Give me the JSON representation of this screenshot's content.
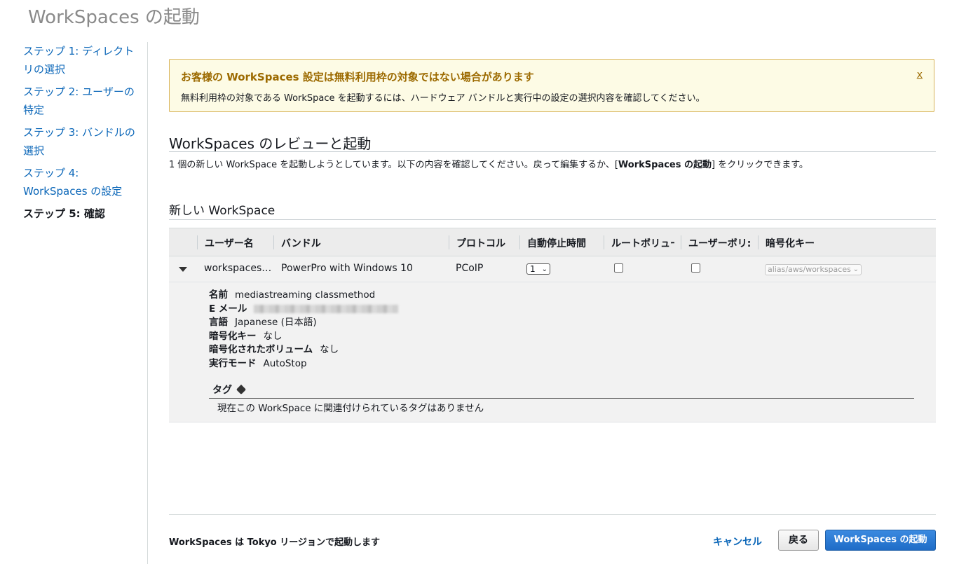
{
  "page": {
    "title": "WorkSpaces の起動"
  },
  "sidebar": {
    "steps": [
      {
        "label": "ステップ 1: ディレクトリの選択"
      },
      {
        "label": "ステップ 2: ユーザーの特定"
      },
      {
        "label": "ステップ 3: バンドルの選択"
      },
      {
        "label": "ステップ 4: WorkSpaces の設定"
      },
      {
        "label": "ステップ 5: 確認",
        "current": true
      }
    ]
  },
  "alert": {
    "title": "お客様の WorkSpaces 設定は無料利用枠の対象ではない場合があります",
    "body": "無料利用枠の対象である WorkSpace を起動するには、ハードウェア バンドルと実行中の設定の選択内容を確認してください。",
    "close": "x",
    "colors": {
      "background": "#fdfbe5",
      "border": "#d8b35a",
      "title": "#9c6a00"
    }
  },
  "review": {
    "title": "WorkSpaces のレビューと起動",
    "intro_pre": "1 個の新しい WorkSpace を起動しようとしています。以下の内容を確認してください。戻って編集するか、[",
    "intro_bold": "WorkSpaces の起動",
    "intro_post": "] をクリックできます。"
  },
  "new_workspace": {
    "title": "新しい WorkSpace",
    "columns": [
      "ユーザー名",
      "バンドル",
      "プロトコル",
      "自動停止時間",
      "ルートボリュー",
      "ユーザーボリ:",
      "暗号化キー"
    ],
    "row": {
      "username": "workspaces…",
      "bundle": "PowerPro with Windows 10",
      "protocol": "PCoIP",
      "auto_stop": "1",
      "root_volume_encrypted": false,
      "user_volume_encrypted": false,
      "encryption_key": "alias/aws/workspaces"
    },
    "details": {
      "name_label": "名前",
      "name_value": "mediastreaming classmethod",
      "email_label": "E メール",
      "language_label": "言語",
      "language_value": "Japanese (日本語)",
      "key_label": "暗号化キー",
      "key_value": "なし",
      "volumes_label": "暗号化されたボリューム",
      "volumes_value": "なし",
      "mode_label": "実行モード",
      "mode_value": "AutoStop"
    },
    "tags": {
      "title": "タグ",
      "icon": "tag-icon",
      "empty": "現在この WorkSpace に関連付けられているタグはありません"
    }
  },
  "footer": {
    "region_text": "WorkSpaces は Tokyo リージョンで起動します",
    "cancel": "キャンセル",
    "back": "戻る",
    "launch": "WorkSpaces の起動",
    "colors": {
      "primary": "#1f6cc7",
      "link": "#0a66b8"
    }
  }
}
